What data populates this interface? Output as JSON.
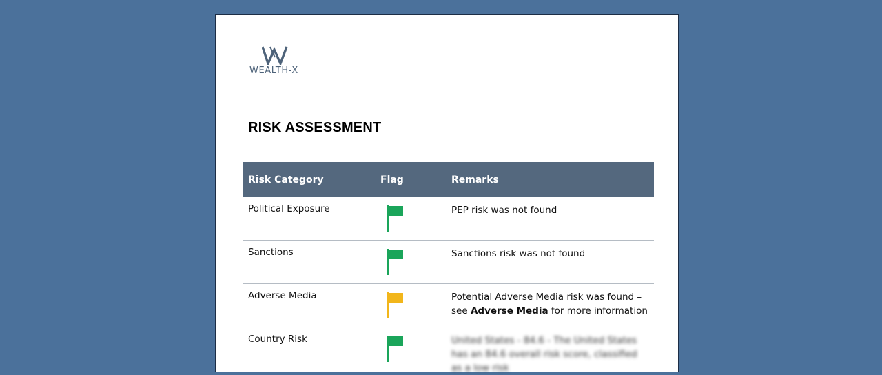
{
  "brand": {
    "name": "WEALTH-X"
  },
  "document": {
    "title": "RISK ASSESSMENT"
  },
  "colors": {
    "background": "#4b719b",
    "header": "#54687e",
    "flag_green": "#1aa55a",
    "flag_yellow": "#f2b61b"
  },
  "table": {
    "headers": [
      "Risk Category",
      "Flag",
      "Remarks"
    ],
    "rows": [
      {
        "category": "Political Exposure",
        "flag": "green",
        "remark": "PEP risk was not found"
      },
      {
        "category": "Sanctions",
        "flag": "green",
        "remark": "Sanctions risk was not found"
      },
      {
        "category": "Adverse Media",
        "flag": "yellow",
        "remark_pre": "Potential Adverse Media risk was found – see",
        "remark_bold": "Adverse Media",
        "remark_post": "for more information"
      },
      {
        "category": "Country Risk",
        "flag": "green",
        "remark": "United States - 84.6 - The United States has an 84.6 overall risk score, classified as a low risk"
      }
    ]
  }
}
